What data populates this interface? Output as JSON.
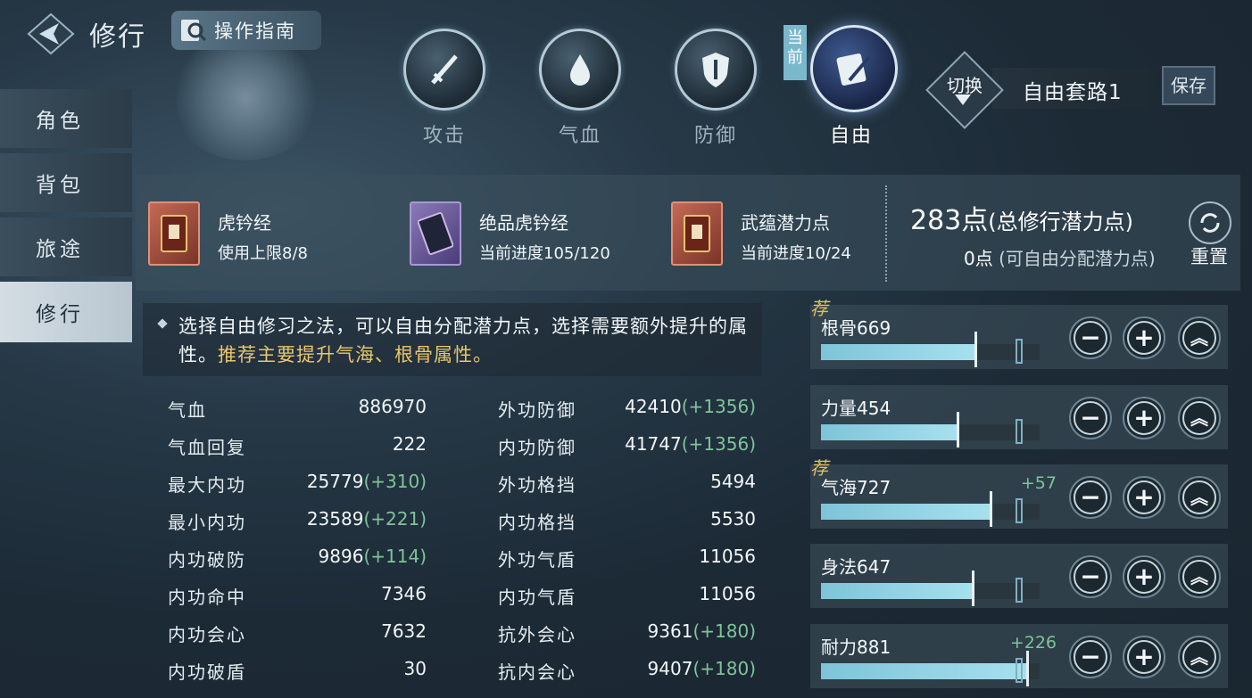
{
  "header": {
    "title": "修行",
    "guide_label": "操作指南"
  },
  "tabs": [
    {
      "label": "攻击",
      "icon": "sword-icon"
    },
    {
      "label": "气血",
      "icon": "blood-drop-icon"
    },
    {
      "label": "防御",
      "icon": "shield-icon"
    },
    {
      "label": "自由",
      "icon": "scroll-icon",
      "active": true
    }
  ],
  "current_tag": "当前",
  "preset": {
    "switch_label": "切换",
    "name": "自由套路1",
    "save_label": "保存"
  },
  "sidebar": [
    {
      "label": "角色"
    },
    {
      "label": "背包"
    },
    {
      "label": "旅途"
    },
    {
      "label": "修行",
      "active": true
    }
  ],
  "materials": [
    {
      "name": "虎钤经",
      "sub": "使用上限8/8",
      "color": "red"
    },
    {
      "name": "绝品虎钤经",
      "sub": "当前进度105/120",
      "color": "purple"
    },
    {
      "name": "武蕴潜力点",
      "sub": "当前进度10/24",
      "color": "red"
    }
  ],
  "points": {
    "total_value": "283点",
    "total_label": "(总修行潜力点)",
    "free_value": "0点",
    "free_label": "(可自由分配潜力点)",
    "reset_label": "重置"
  },
  "description": {
    "text": "选择自由修习之法，可以自由分配潜力点，选择需要额外提升的属性。",
    "highlight": "推荐主要提升气海、根骨属性。"
  },
  "stats_left": [
    {
      "label": "气血",
      "value": "886970",
      "bonus": ""
    },
    {
      "label": "气血回复",
      "value": "222",
      "bonus": ""
    },
    {
      "label": "最大内功",
      "value": "25779",
      "bonus": "(+310)"
    },
    {
      "label": "最小内功",
      "value": "23589",
      "bonus": "(+221)"
    },
    {
      "label": "内功破防",
      "value": "9896",
      "bonus": "(+114)"
    },
    {
      "label": "内功命中",
      "value": "7346",
      "bonus": ""
    },
    {
      "label": "内功会心",
      "value": "7632",
      "bonus": ""
    },
    {
      "label": "内功破盾",
      "value": "30",
      "bonus": ""
    }
  ],
  "stats_right": [
    {
      "label": "外功防御",
      "value": "42410",
      "bonus": "(+1356)"
    },
    {
      "label": "内功防御",
      "value": "41747",
      "bonus": "(+1356)"
    },
    {
      "label": "外功格挡",
      "value": "5494",
      "bonus": ""
    },
    {
      "label": "内功格挡",
      "value": "5530",
      "bonus": ""
    },
    {
      "label": "外功气盾",
      "value": "11056",
      "bonus": ""
    },
    {
      "label": "内功气盾",
      "value": "11056",
      "bonus": ""
    },
    {
      "label": "抗外会心",
      "value": "9361",
      "bonus": "(+180)"
    },
    {
      "label": "抗内会心",
      "value": "9407",
      "bonus": "(+180)"
    }
  ],
  "attributes": [
    {
      "name": "根骨669",
      "bonus": "",
      "recommended": true,
      "fill": 0.7,
      "mark": 0.89
    },
    {
      "name": "力量454",
      "bonus": "",
      "recommended": false,
      "fill": 0.62,
      "mark": 0.89
    },
    {
      "name": "气海727",
      "bonus": "+57",
      "recommended": true,
      "fill": 0.77,
      "mark": 0.89
    },
    {
      "name": "身法647",
      "bonus": "",
      "recommended": false,
      "fill": 0.69,
      "mark": 0.89
    },
    {
      "name": "耐力881",
      "bonus": "+226",
      "recommended": false,
      "fill": 0.94,
      "mark": 0.89
    }
  ],
  "recommend_tag": "荐",
  "attr_buttons": {
    "minus": "−",
    "plus": "+",
    "max": "︽"
  },
  "colors": {
    "bonus": "#7fc49a",
    "highlight": "#e8c86a",
    "recommend": "#e8c05a",
    "bar": "#a6e0ee"
  }
}
